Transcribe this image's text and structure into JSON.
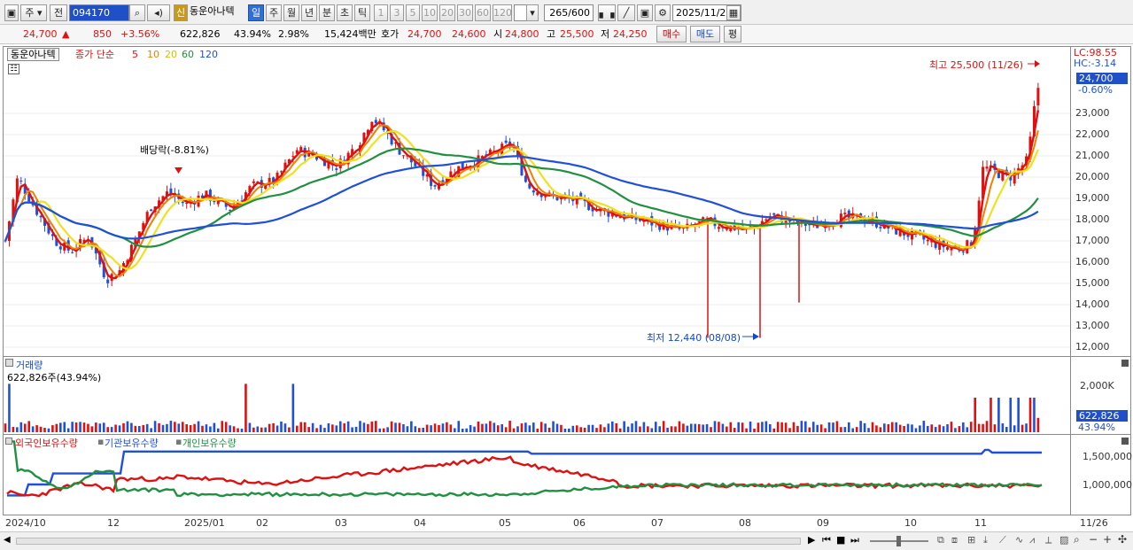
{
  "toolbar": {
    "period_label": "주",
    "prev_label": "전",
    "code_value": "094170",
    "badge_new": "신",
    "stock_name": "동운아나텍",
    "period_buttons": [
      "일",
      "주",
      "월",
      "년",
      "분",
      "초",
      "틱"
    ],
    "interval_buttons": [
      "1",
      "3",
      "5",
      "10",
      "20",
      "30",
      "60",
      "120"
    ],
    "count_value": "265",
    "count_total": "/600",
    "date_value": "2025/11/26"
  },
  "quote": {
    "price": "24,700",
    "change_arrow": "▲",
    "change": "850",
    "change_pct": "+3.56%",
    "volume": "622,826",
    "volume_ratio": "43.94%",
    "turnover": "2.98%",
    "amount": "15,424백만",
    "hoga_label": "호가",
    "ask": "24,700",
    "bid": "24,600",
    "open_label": "시",
    "open": "24,800",
    "high_label": "고",
    "high": "25,500",
    "low_label": "저",
    "low": "24,250",
    "buy_button": "매수",
    "sell_button": "매도",
    "eval_button": "평"
  },
  "price_panel": {
    "name_box": "동운아나텍",
    "legend_prefix": "종가 단순",
    "ma_labels": [
      "5",
      "10",
      "20",
      "60",
      "120"
    ],
    "ma_colors": [
      "#e01010",
      "#f08000",
      "#f0e020",
      "#209040",
      "#2050d8"
    ],
    "dividend_label": "배당락(-8.81%)",
    "high_annotation": "최고 25,500 (11/26)",
    "low_annotation": "최저 12,440 (08/08)",
    "lc_label": "LC:98.55",
    "hc_label": "HC:-3.14",
    "last_price_tag": "24,700",
    "last_change_tag": "-0.60%",
    "y_labels": [
      "23,000",
      "22,000",
      "21,000",
      "20,000",
      "19,000",
      "18,000",
      "17,000",
      "16,000",
      "15,000",
      "14,000",
      "13,000",
      "12,000"
    ]
  },
  "volume_panel": {
    "title": "거래량",
    "subtitle": "622,826주(43.94%)",
    "y_label": "2,000K",
    "last_tag": "622,826",
    "ratio_tag": "43.94%"
  },
  "holdings_panel": {
    "legend": [
      "외국인보유수량",
      "기관보유수량",
      "개인보유수량"
    ],
    "legend_colors": [
      "#e01010",
      "#2050d8",
      "#209040"
    ],
    "y_labels": [
      "1,500,000",
      "1,000,000"
    ]
  },
  "x_axis": [
    "2024/10",
    "12",
    "2025/01",
    "02",
    "03",
    "04",
    "05",
    "06",
    "07",
    "08",
    "09",
    "10",
    "11",
    "11/26"
  ],
  "chart_data": {
    "type": "line",
    "title": "동운아나텍",
    "xlabel": "",
    "ylabel": "",
    "ylim": [
      12000,
      24000
    ],
    "series": [
      {
        "name": "종가",
        "points": [
          {
            "x": "2024/10",
            "y": 17000
          },
          {
            "x": "2024/10 mid",
            "y": 19000
          },
          {
            "x": "2024/11",
            "y": 16500
          },
          {
            "x": "2024/12",
            "y": 15000
          },
          {
            "x": "2025/01",
            "y": 18500
          },
          {
            "x": "2025/02",
            "y": 19500
          },
          {
            "x": "2025/03",
            "y": 21500
          },
          {
            "x": "2025/03 end",
            "y": 22800
          },
          {
            "x": "2025/04",
            "y": 20000
          },
          {
            "x": "2025/05",
            "y": 21800
          },
          {
            "x": "2025/06",
            "y": 19000
          },
          {
            "x": "2025/07",
            "y": 18000
          },
          {
            "x": "2025/08",
            "y": 17800
          },
          {
            "x": "2025/09",
            "y": 18000
          },
          {
            "x": "2025/10",
            "y": 17000
          },
          {
            "x": "2025/11",
            "y": 20500
          },
          {
            "x": "11/26",
            "y": 24700
          }
        ]
      }
    ]
  }
}
